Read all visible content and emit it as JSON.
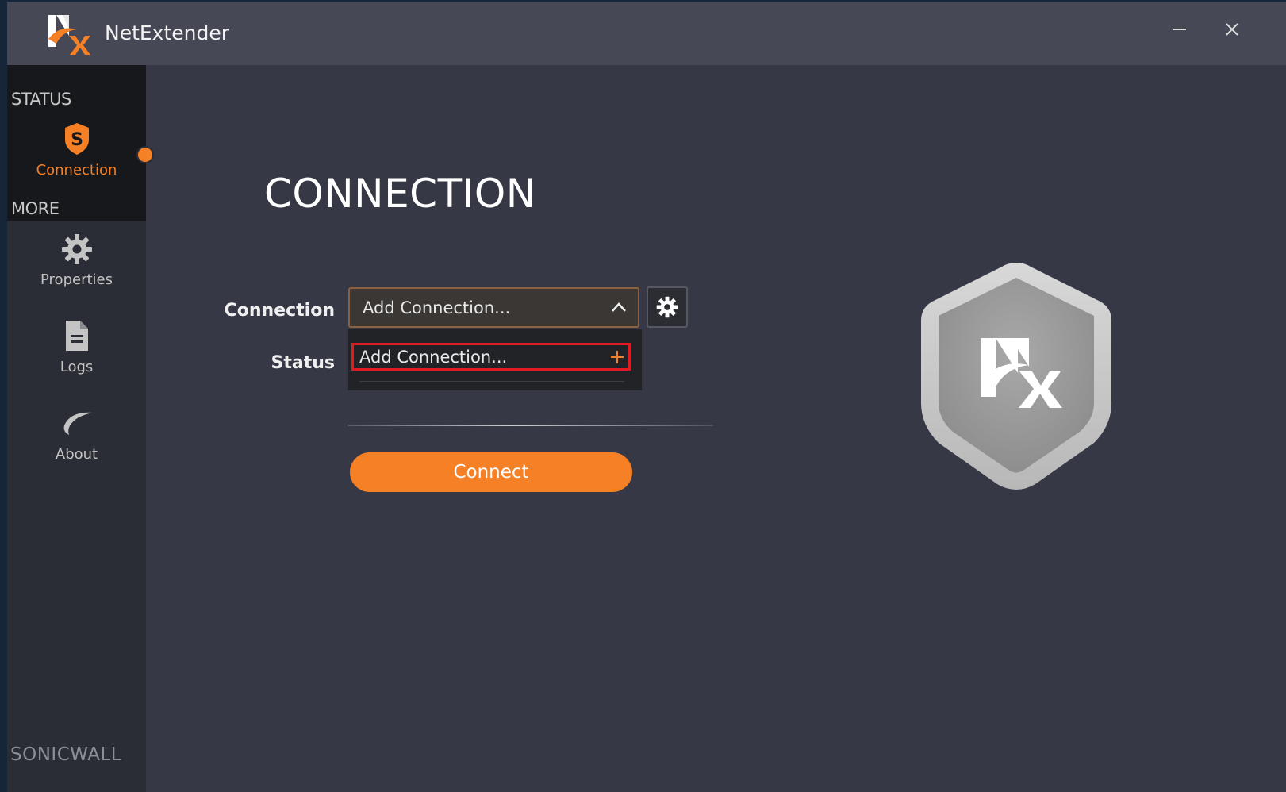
{
  "window": {
    "title": "NetExtender",
    "minimize_icon": "minimize-icon",
    "close_icon": "close-icon"
  },
  "sidebar": {
    "status_header": "STATUS",
    "more_header": "MORE",
    "items": [
      {
        "label": "Connection",
        "icon": "sonicwall-shield-icon",
        "active": true
      },
      {
        "label": "Properties",
        "icon": "gear-icon",
        "active": false
      },
      {
        "label": "Logs",
        "icon": "document-icon",
        "active": false
      },
      {
        "label": "About",
        "icon": "swoosh-icon",
        "active": false
      }
    ],
    "brand": "SONICWALL"
  },
  "main": {
    "title": "CONNECTION",
    "connection_label": "Connection",
    "status_label": "Status",
    "connection_select": {
      "selected": "Add Connection..."
    },
    "dropdown": {
      "options": [
        {
          "label": "Add Connection...",
          "icon": "plus-icon"
        }
      ]
    },
    "connect_button": "Connect"
  },
  "colors": {
    "accent": "#f58026",
    "highlight_border": "#e11b22",
    "background": "#363945",
    "titlebar": "#464955",
    "sidebar": "#2a2d35"
  }
}
